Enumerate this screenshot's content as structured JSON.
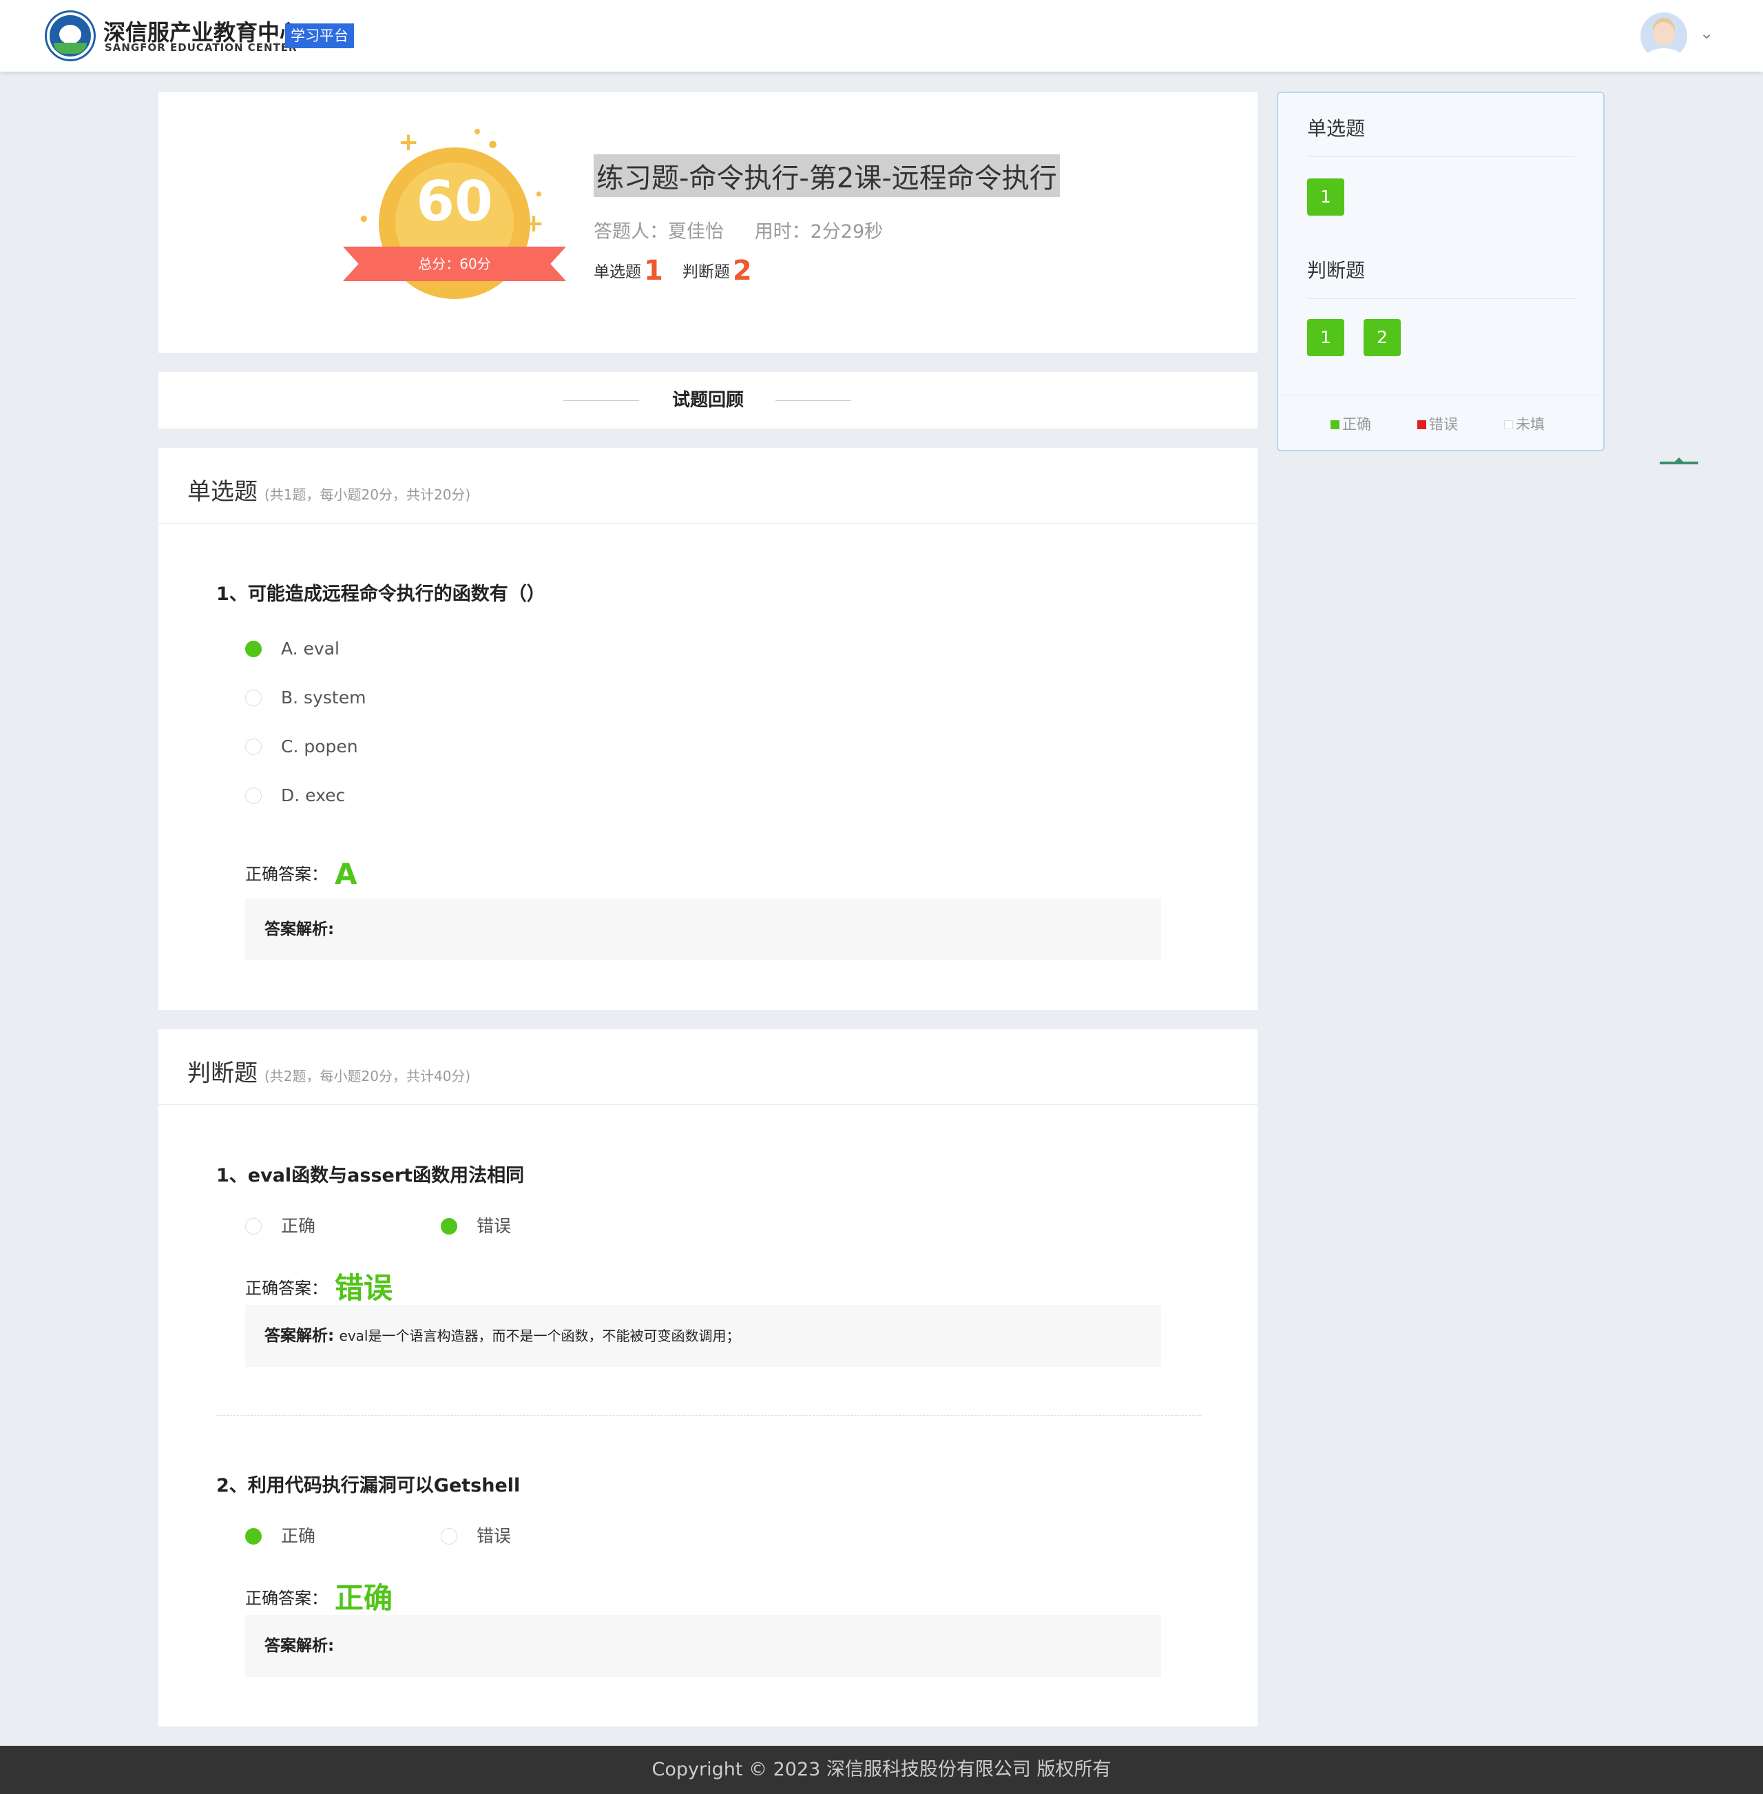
{
  "header": {
    "brand_cn": "深信服产业教育中心",
    "brand_en": "SANGFOR EDUCATION CENTER",
    "tag": "学习平台",
    "dropdown_icon": "chevron-down-icon"
  },
  "score": {
    "value": "60",
    "total_label": "总分：60分",
    "title": "练习题-命令执行-第2课-远程命令执行",
    "answerer": "答题人：夏佳怡",
    "time_used": "用时：2分29秒",
    "single_label": "单选题",
    "single_count": "1",
    "judge_label": "判断题",
    "judge_count": "2"
  },
  "review_title": "试题回顾",
  "single_section": {
    "title": "单选题",
    "subtitle": "(共1题，每小题20分，共计20分)",
    "questions": [
      {
        "text": "1、可能造成远程命令执行的函数有（）",
        "options": [
          "A. eval",
          "B. system",
          "C. popen",
          "D. exec"
        ],
        "selected": 0,
        "answer_label": "正确答案：",
        "answer": "A",
        "explain_label": "答案解析:",
        "explain": ""
      }
    ]
  },
  "judge_section": {
    "title": "判断题",
    "subtitle": "(共2题，每小题20分，共计40分)",
    "questions": [
      {
        "text": "1、eval函数与assert函数用法相同",
        "options": [
          "正确",
          "错误"
        ],
        "selected": 1,
        "answer_label": "正确答案：",
        "answer": "错误",
        "explain_label": "答案解析:",
        "explain": "eval是一个语言构造器，而不是一个函数，不能被可变函数调用；"
      },
      {
        "text": "2、利用代码执行漏洞可以Getshell",
        "options": [
          "正确",
          "错误"
        ],
        "selected": 0,
        "answer_label": "正确答案：",
        "answer": "正确",
        "explain_label": "答案解析:",
        "explain": ""
      }
    ]
  },
  "sidebar": {
    "single_title": "单选题",
    "single_items": [
      "1"
    ],
    "judge_title": "判断题",
    "judge_items": [
      "1",
      "2"
    ],
    "legend": [
      {
        "label": "正确",
        "color": "#52c41a"
      },
      {
        "label": "错误",
        "color": "#e02020"
      },
      {
        "label": "未填",
        "color": "#ffffff"
      }
    ]
  },
  "colors": {
    "accent": "#2d6cdf",
    "correct": "#52c41a",
    "score_orange": "#f0592e",
    "ribbon": "#f96a5d",
    "coin": "#f4bd45"
  },
  "footer": "Copyright © 2023 深信服科技股份有限公司 版权所有"
}
